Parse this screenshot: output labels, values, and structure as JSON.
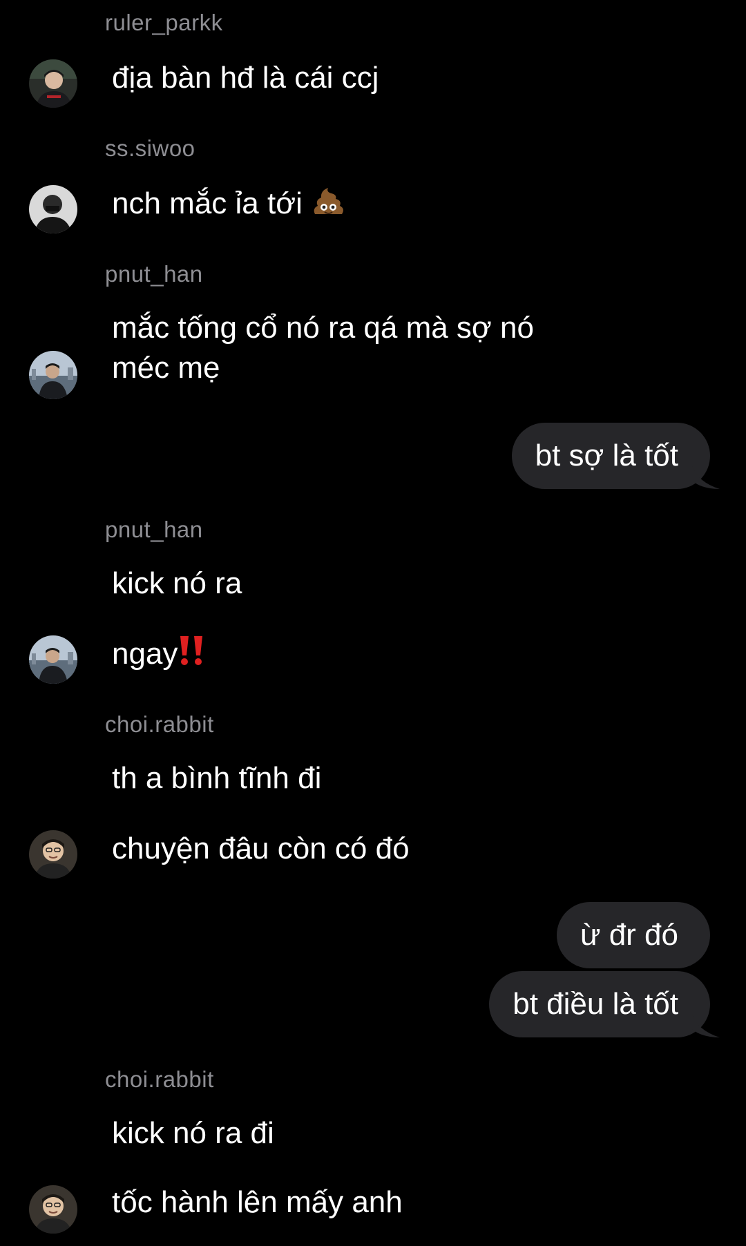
{
  "colors": {
    "background": "#000000",
    "sender_text": "#8e8e93",
    "message_text": "#ffffff",
    "outgoing_bubble": "#262629"
  },
  "messages": [
    {
      "sender": "ruler_parkk",
      "text": "địa bàn hđ là cái ccj",
      "avatar": "avatar-ruler-parkk"
    },
    {
      "sender": "ss.siwoo",
      "text": "nch mắc ỉa tới",
      "emoji": "poop-emoji",
      "avatar": "avatar-ss-siwoo"
    },
    {
      "sender": "pnut_han",
      "line1": "mắc tống cổ nó ra qá mà sợ nó",
      "line2": "méc mẹ",
      "avatar": "avatar-pnut-han"
    },
    {
      "outgoing": "bt sợ là tốt"
    },
    {
      "sender": "pnut_han",
      "line1": "kick nó ra",
      "line2": "ngay",
      "emoji": "double-exclamation-emoji",
      "avatar": "avatar-pnut-han"
    },
    {
      "sender": "choi.rabbit",
      "line1": "th a bình tĩnh đi",
      "line2": "chuyện đâu còn có đó",
      "avatar": "avatar-choi-rabbit"
    },
    {
      "outgoing1": "ừ đr đó",
      "outgoing2": "bt điều là tốt"
    },
    {
      "sender": "choi.rabbit",
      "line1": "kick nó ra đi",
      "line2": "tốc hành lên mấy anh",
      "avatar": "avatar-choi-rabbit"
    }
  ]
}
